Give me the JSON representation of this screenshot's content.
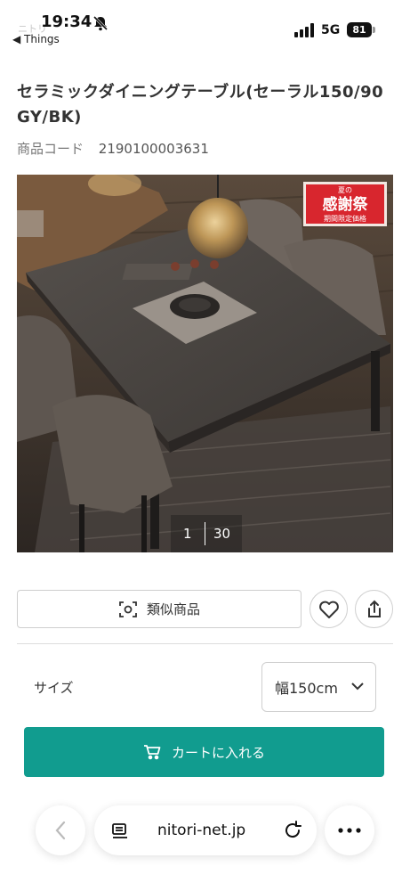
{
  "status_bar": {
    "time": "19:34",
    "back_label": "◀ Things",
    "network": "5G",
    "battery": "81"
  },
  "product": {
    "title": "セラミックダイニングテーブル(セーラル150/90 GY/BK)",
    "code_label": "商品コード",
    "code_value": "2190100003631"
  },
  "gallery": {
    "badge_top": "夏の",
    "badge_main": "感謝祭",
    "badge_sub": "期間限定価格",
    "current": "1",
    "total": "30"
  },
  "actions": {
    "similar_label": "類似商品"
  },
  "options": {
    "size_label": "サイズ",
    "size_value": "幅150cm"
  },
  "cart": {
    "label": "カートに入れる",
    "color": "#119c8f"
  },
  "browser": {
    "url": "nitori-net.jp"
  }
}
